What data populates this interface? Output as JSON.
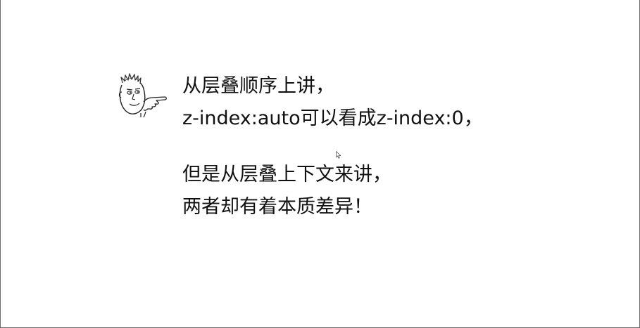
{
  "slide": {
    "lines": [
      "从层叠顺序上讲，",
      "z-index:auto可以看成z-index:0，",
      "但是从层叠上下文来讲，",
      "两者却有着本质差异！"
    ]
  },
  "icons": {
    "avatar": "pointing-face-avatar",
    "cursor": "mouse-pointer-icon"
  }
}
